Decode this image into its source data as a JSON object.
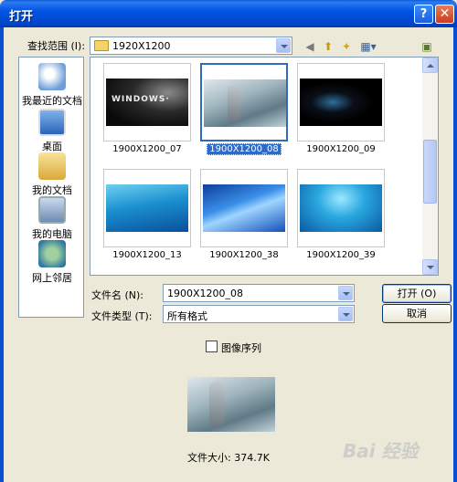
{
  "window": {
    "title": "打开",
    "help": "?",
    "close": "✕"
  },
  "look_in": {
    "label": "查找范围 (I):",
    "value": "1920X1200"
  },
  "places": [
    {
      "label": "我最近的文档",
      "icon": "recent-docs-icon",
      "color": "#6f9fd8"
    },
    {
      "label": "桌面",
      "icon": "desktop-icon",
      "color": "#3d79c9"
    },
    {
      "label": "我的文档",
      "icon": "my-documents-icon",
      "color": "#e8c65a"
    },
    {
      "label": "我的电脑",
      "icon": "my-computer-icon",
      "color": "#8aa6c9"
    },
    {
      "label": "网上邻居",
      "icon": "network-places-icon",
      "color": "#4a9b4a"
    }
  ],
  "files": [
    {
      "name": "1900X1200_07",
      "style": "windows-dark",
      "selected": false
    },
    {
      "name": "1900X1200_08",
      "style": "robot",
      "selected": true
    },
    {
      "name": "1900X1200_09",
      "style": "black-fish",
      "selected": false
    },
    {
      "name": "1900X1200_13",
      "style": "blue-aero",
      "selected": false
    },
    {
      "name": "1900X1200_38",
      "style": "blue-swirl",
      "selected": false
    },
    {
      "name": "1900X1200_39",
      "style": "blue-water",
      "selected": false
    }
  ],
  "filename": {
    "label": "文件名 (N):",
    "value": "1900X1200_08"
  },
  "filetype": {
    "label": "文件类型 (T):",
    "value": "所有格式"
  },
  "buttons": {
    "open": "打开 (O)",
    "cancel": "取消"
  },
  "sequence_label": "图像序列",
  "file_size": "文件大小: 374.7K",
  "watermark": "Bai 经验"
}
